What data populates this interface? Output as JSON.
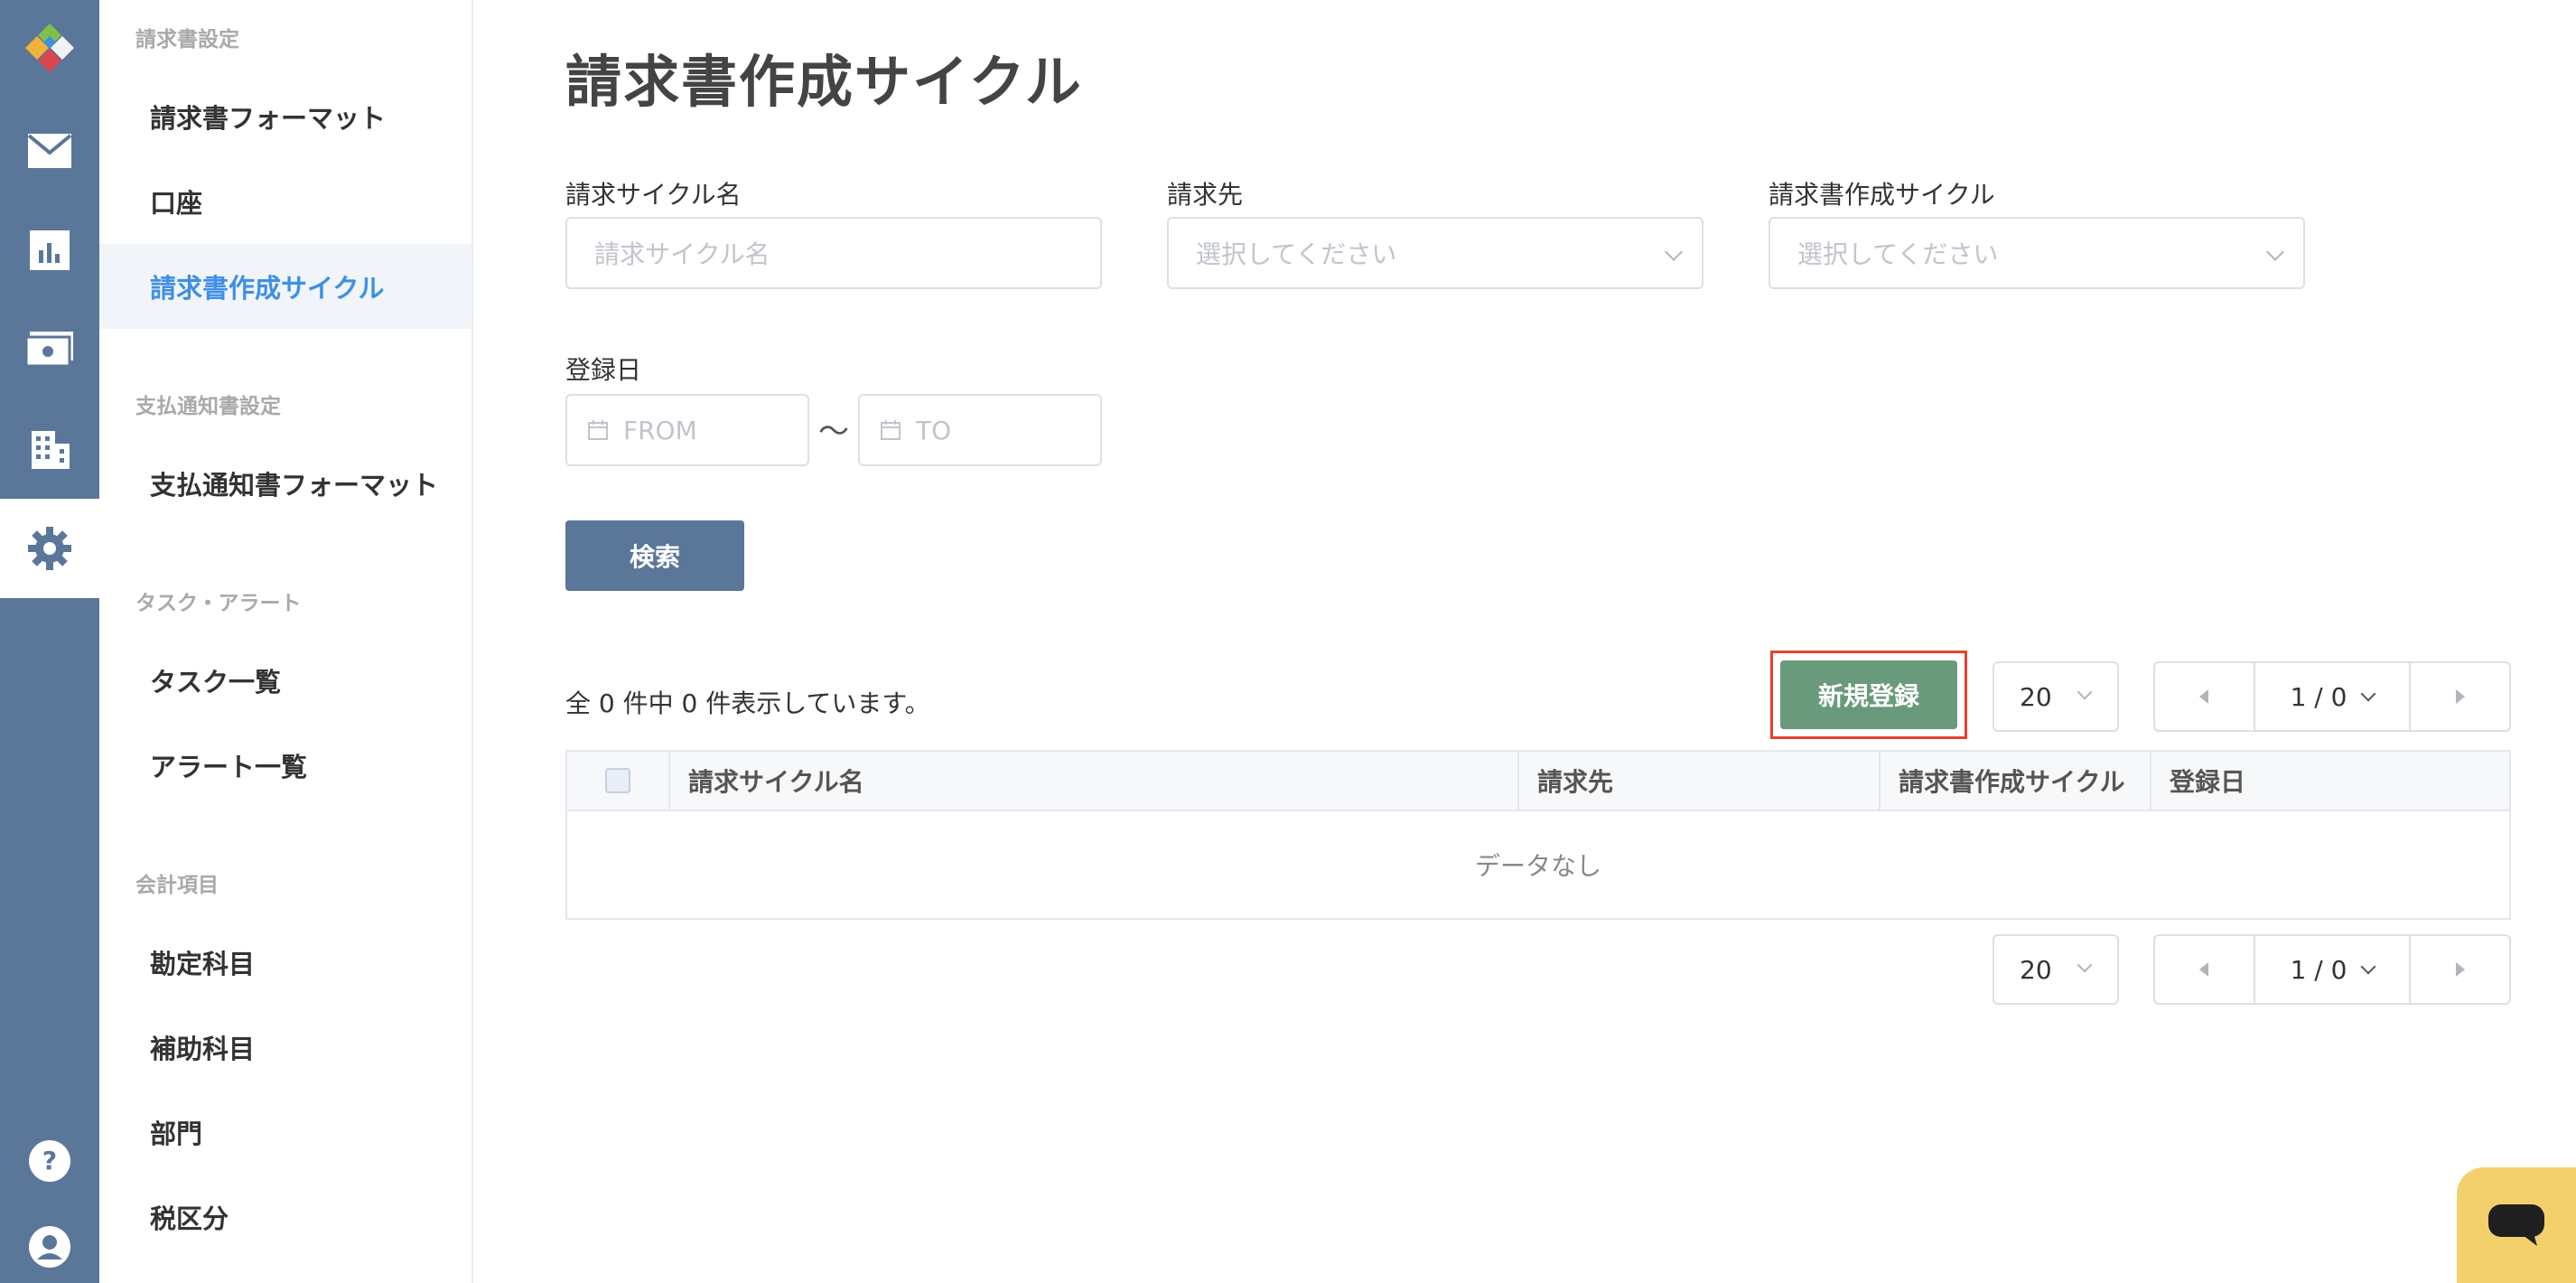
{
  "colors": {
    "rail": "#5a7799",
    "active_link": "#3f8fe6",
    "primary_button": "#5a7799",
    "success_button": "#6a9a7c",
    "highlight_border": "#e8402a",
    "chat": "#f3d06c"
  },
  "rail": {
    "items": [
      "logo-icon",
      "mail-icon",
      "chart-icon",
      "money-icon",
      "building-icon",
      "gear-icon",
      "help-icon",
      "user-icon"
    ]
  },
  "sidebar": {
    "sections": [
      {
        "title": "請求書設定",
        "items": [
          "請求書フォーマット",
          "口座",
          "請求書作成サイクル"
        ]
      },
      {
        "title": "支払通知書設定",
        "items": [
          "支払通知書フォーマット"
        ]
      },
      {
        "title": "タスク・アラート",
        "items": [
          "タスク一覧",
          "アラート一覧"
        ]
      },
      {
        "title": "会計項目",
        "items": [
          "勘定科目",
          "補助科目",
          "部門",
          "税区分"
        ]
      }
    ],
    "active_item": "請求書作成サイクル"
  },
  "main": {
    "title": "請求書作成サイクル",
    "filters": {
      "cycle_name_label": "請求サイクル名",
      "cycle_name_placeholder": "請求サイクル名",
      "client_label": "請求先",
      "client_placeholder": "選択してください",
      "cycle_label": "請求書作成サイクル",
      "cycle_placeholder": "選択してください",
      "date_label": "登録日",
      "date_from_placeholder": "FROM",
      "date_to_placeholder": "TO",
      "date_separator": "〜"
    },
    "search_button": "検索",
    "count_text": "全 0 件中 0 件表示しています。",
    "new_button": "新規登録",
    "per_page": "20",
    "page_indicator": "1 / 0",
    "table": {
      "columns": [
        "請求サイクル名",
        "請求先",
        "請求書作成サイクル",
        "登録日"
      ],
      "empty_text": "データなし"
    }
  }
}
